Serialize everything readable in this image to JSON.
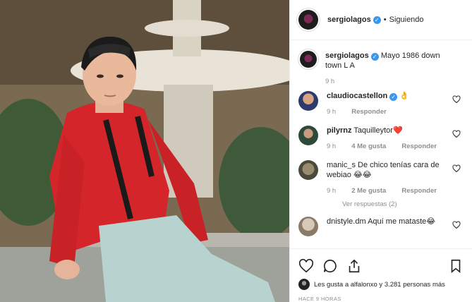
{
  "post": {
    "photo_description_icon": "photo",
    "author": "sergiolagos",
    "follow_status": "Siguiendo",
    "verified_icon": "verified-badge-icon"
  },
  "caption": {
    "username": "sergiolagos",
    "text": "Mayo 1986 down town L A",
    "time": "9 h"
  },
  "comments": [
    {
      "username": "claudiocastellon",
      "text": "👌",
      "time": "9 h",
      "likes": "",
      "reply": "Responder",
      "verified": true
    },
    {
      "username": "pilyrnz",
      "text": "Taquilleytor❤️",
      "time": "9 h",
      "likes": "4 Me gusta",
      "reply": "Responder",
      "verified": false
    },
    {
      "username": "manic_s",
      "text": "De chico tenías cara de webiao 😂😂",
      "time": "9 h",
      "likes": "2 Me gusta",
      "reply": "Responder",
      "verified": false,
      "view_replies": "Ver respuestas (2)"
    },
    {
      "username": "dnistyle.dm",
      "text": "Aquí me mataste😂",
      "time": "",
      "likes": "",
      "reply": "",
      "verified": false
    }
  ],
  "footer": {
    "likes_text": "Les gusta a alfalonxo y 3.281 personas más",
    "timestamp": "HACE 9 HORAS"
  },
  "colors": {
    "link_blue": "#3897f0",
    "meta_gray": "#8e8e8e",
    "text": "#262626"
  }
}
